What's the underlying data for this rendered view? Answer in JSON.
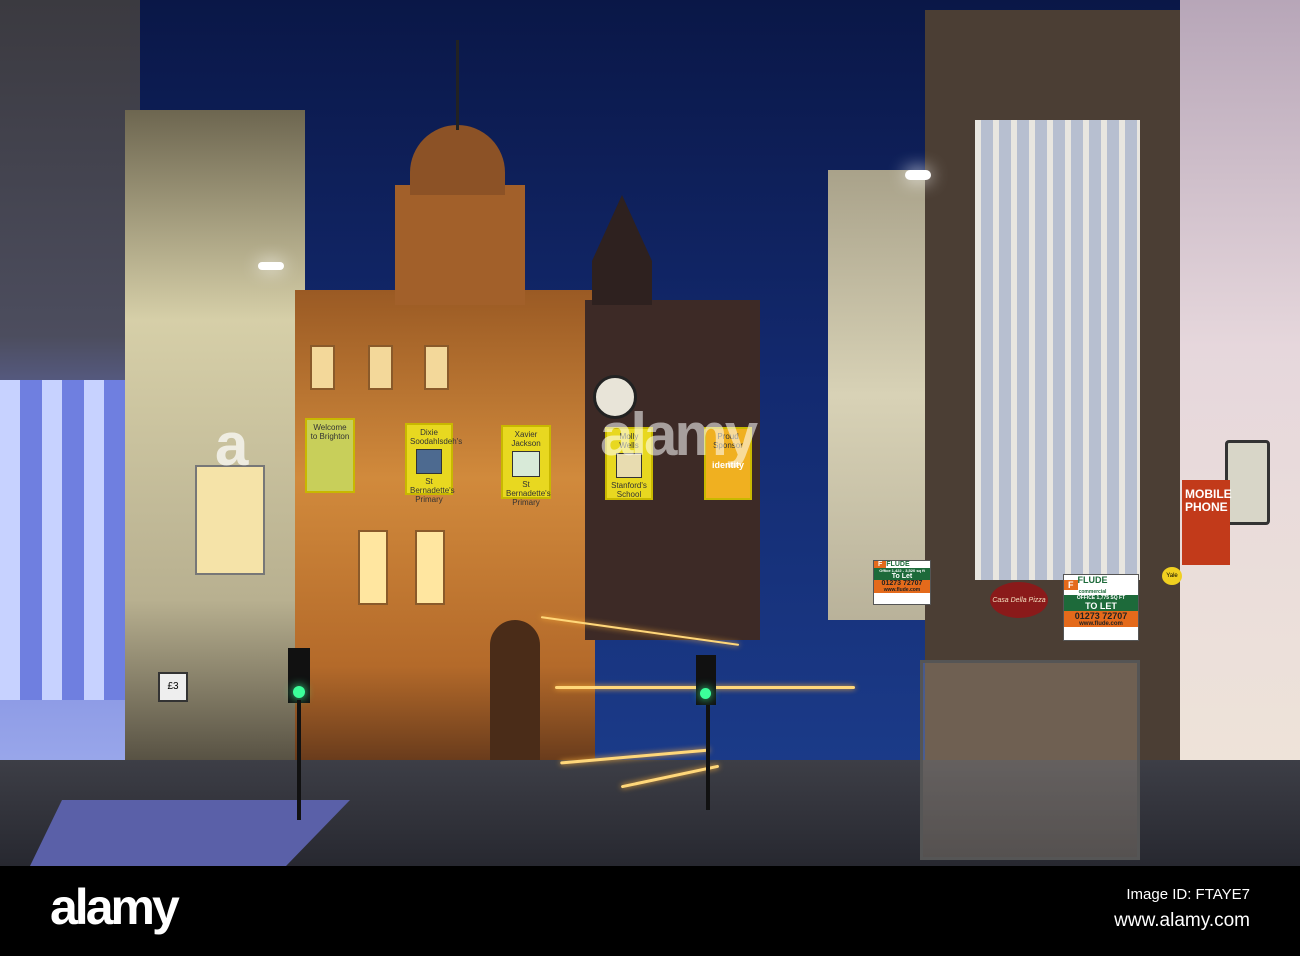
{
  "watermark": {
    "logo": "alamy",
    "image_id": "Image ID: FTAYE7",
    "url": "www.alamy.com",
    "overlay_letter": "a"
  },
  "banners": [
    {
      "title": "Welcome to Brighton",
      "footer": ""
    },
    {
      "title": "Dixie Soodahlsdeh's",
      "footer": "St Bernadette's Primary"
    },
    {
      "title": "Xavier Jackson",
      "footer": "St Bernadette's Primary"
    },
    {
      "title": "Molly Wells",
      "footer": "Stanford's School"
    },
    {
      "title": "Proud Sponsor",
      "brand": "identity"
    }
  ],
  "signs": {
    "flude_left": {
      "brand": "FLUDE",
      "line1": "Office 1,422 - 3,520 sq ft",
      "line2": "To Let",
      "phone": "01273 72707",
      "web": "www.flude.com"
    },
    "flude_right": {
      "brand": "FLUDE",
      "sub": "commercial",
      "line1": "OFFICE 1,775 SQ FT",
      "line2": "TO LET",
      "phone": "01273 72707",
      "web": "www.flude.com"
    },
    "pizza": "Casa Della Pizza",
    "mobile": "MOBILE PHONE",
    "yale": "Yale",
    "parking": "£3"
  }
}
